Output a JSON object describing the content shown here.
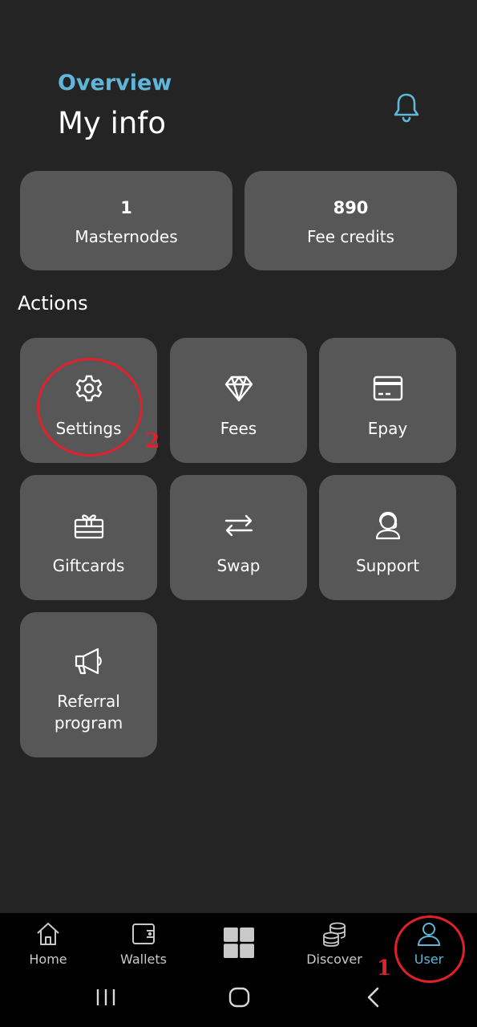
{
  "header": {
    "subtitle": "Overview",
    "title": "My info"
  },
  "stats": [
    {
      "value": "1",
      "label": "Masternodes"
    },
    {
      "value": "890",
      "label": "Fee credits"
    }
  ],
  "actions": {
    "title": "Actions",
    "items": [
      {
        "label": "Settings",
        "icon": "gear-icon"
      },
      {
        "label": "Fees",
        "icon": "diamond-icon"
      },
      {
        "label": "Epay",
        "icon": "credit-card-icon"
      },
      {
        "label": "Giftcards",
        "icon": "gift-icon"
      },
      {
        "label": "Swap",
        "icon": "swap-arrows-icon"
      },
      {
        "label": "Support",
        "icon": "support-agent-icon"
      },
      {
        "label": "Referral program",
        "icon": "megaphone-icon"
      }
    ]
  },
  "bottom_nav": {
    "items": [
      {
        "label": "Home",
        "icon": "home-icon"
      },
      {
        "label": "Wallets",
        "icon": "wallet-icon"
      },
      {
        "label": "",
        "icon": "grid-icon"
      },
      {
        "label": "Discover",
        "icon": "coins-stack-icon"
      },
      {
        "label": "User",
        "icon": "user-icon",
        "active": true
      }
    ]
  },
  "annotations": {
    "first": "1",
    "second": "2",
    "color": "#e0202a"
  },
  "colors": {
    "accent": "#5fb6d8",
    "background": "#242424",
    "card": "#575757",
    "nav_background": "#000000"
  }
}
